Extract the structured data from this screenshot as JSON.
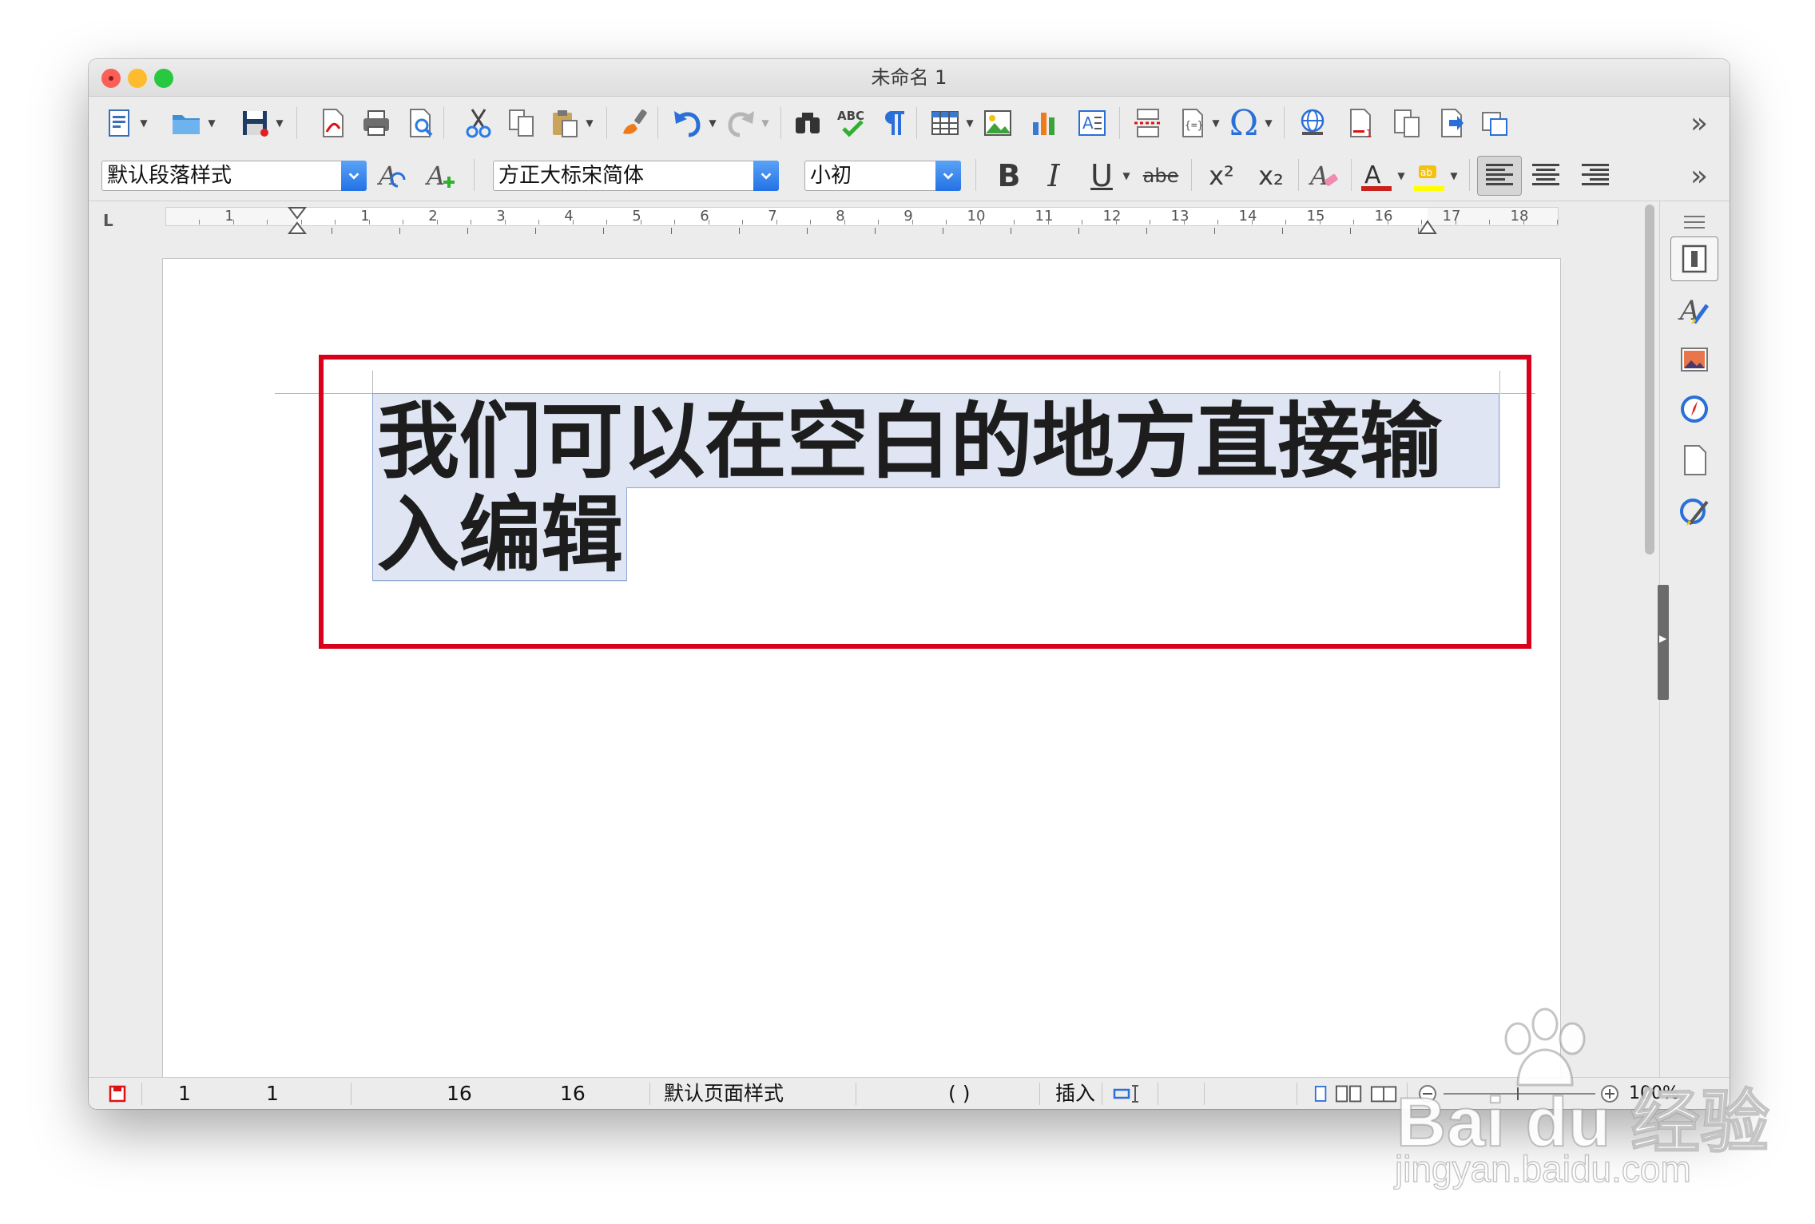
{
  "window": {
    "title": "未命名 1",
    "traffic_colors": {
      "close": "#fc5f57",
      "minimize": "#fdbc2e",
      "zoom": "#28c840"
    }
  },
  "toolbar_standard": {
    "icons": [
      "new-document-icon",
      "open-folder-icon",
      "save-icon",
      "export-pdf-icon",
      "print-icon",
      "print-preview-icon",
      "cut-icon",
      "copy-icon",
      "paste-icon",
      "clone-formatting-icon",
      "undo-icon",
      "redo-icon",
      "find-replace-icon",
      "spellcheck-icon",
      "formatting-marks-icon",
      "insert-table-icon",
      "insert-image-icon",
      "insert-chart-icon",
      "insert-textbox-icon",
      "page-break-icon",
      "insert-field-icon",
      "special-character-icon",
      "hyperlink-icon",
      "footnote-icon",
      "comment-icon",
      "track-changes-icon",
      "insert-frame-icon"
    ],
    "spellcheck_label": "ABC",
    "special_char_glyph": "Ω",
    "overflow": "»"
  },
  "toolbar_format": {
    "paragraph_style": "默认段落样式",
    "font_name": "方正大标宋简体",
    "font_size": "小初",
    "bold": "B",
    "italic": "I",
    "underline": "U",
    "strikethrough": "abe",
    "superscript": "x²",
    "subscript": "x₂",
    "overflow": "»"
  },
  "ruler": {
    "labels": [
      "1",
      "1",
      "2",
      "3",
      "4",
      "5",
      "6",
      "7",
      "8",
      "9",
      "10",
      "11",
      "12",
      "13",
      "14",
      "15",
      "16",
      "17",
      "18"
    ],
    "tab_icon": "L"
  },
  "document": {
    "line1": "我们可以在空白的地方直接输",
    "line2": "入编辑",
    "highlight_color": "#d8001b"
  },
  "sidebar": {
    "icons": [
      "properties-icon",
      "styles-icon",
      "gallery-icon",
      "navigator-icon",
      "page-icon",
      "manage-changes-icon"
    ]
  },
  "statusbar": {
    "page": "1",
    "page_total": "1",
    "words": "16",
    "chars": "16",
    "page_style": "默认页面样式",
    "language": "(      )",
    "insert_mode": "插入",
    "zoom": "100%"
  },
  "watermark": {
    "brand": "Bai du 经验",
    "url": "jingyan.baidu.com"
  }
}
